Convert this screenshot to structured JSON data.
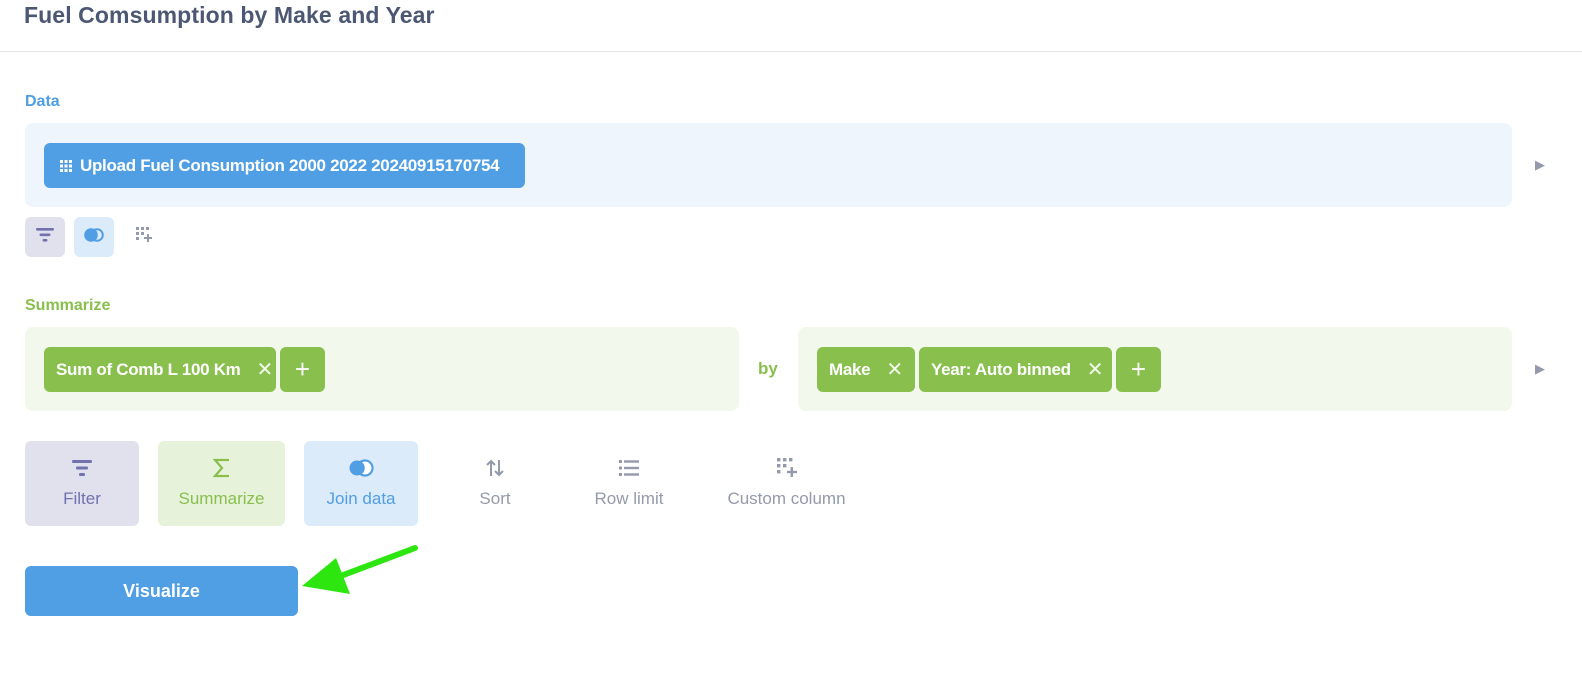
{
  "title": "Fuel Comsumption by Make and Year",
  "data_section": {
    "label": "Data",
    "table_name": "Upload Fuel Consumption 2000 2022 20240915170754",
    "table_icon": "grid-icon",
    "mini_tools": [
      "filter-icon",
      "join-icon",
      "custom-column-icon"
    ]
  },
  "summarize_section": {
    "label": "Summarize",
    "metrics": [
      {
        "label": "Sum of Comb L 100 Km"
      }
    ],
    "by_label": "by",
    "breakouts": [
      {
        "label": "Make"
      },
      {
        "label": "Year: Auto binned"
      }
    ],
    "add_symbol": "+",
    "remove_symbol": "✕"
  },
  "actions": [
    {
      "id": "filter",
      "label": "Filter",
      "icon": "filter-icon"
    },
    {
      "id": "summarize",
      "label": "Summarize",
      "icon": "sigma-icon"
    },
    {
      "id": "join",
      "label": "Join data",
      "icon": "join-icon"
    },
    {
      "id": "sort",
      "label": "Sort",
      "icon": "sort-icon"
    },
    {
      "id": "limit",
      "label": "Row limit",
      "icon": "list-icon"
    },
    {
      "id": "custom",
      "label": "Custom column",
      "icon": "custom-column-icon"
    }
  ],
  "visualize_label": "Visualize",
  "colors": {
    "brand": "#509ee3",
    "summarize": "#88bf4d",
    "filter": "#7172ad",
    "annotation_arrow": "#2ee60f"
  }
}
